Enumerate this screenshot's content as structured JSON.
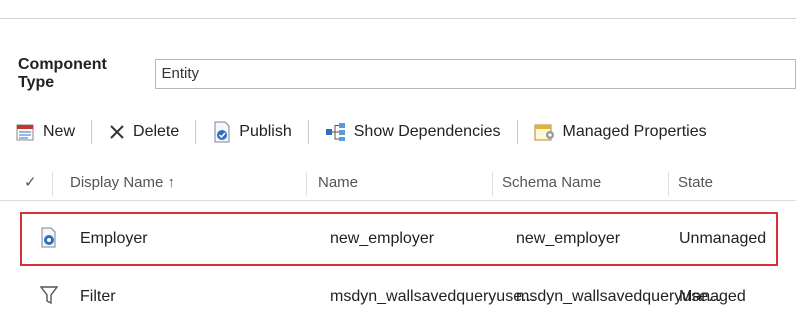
{
  "component_type": {
    "label": "Component Type",
    "value": "Entity"
  },
  "toolbar": {
    "new_label": "New",
    "delete_label": "Delete",
    "publish_label": "Publish",
    "show_dependencies_label": "Show Dependencies",
    "managed_properties_label": "Managed Properties"
  },
  "grid": {
    "check_column": "✓",
    "columns": [
      "Display Name ↑",
      "Name",
      "Schema Name",
      "State"
    ],
    "rows": [
      {
        "icon": "entity-icon",
        "display_name": "Employer",
        "name": "new_employer",
        "schema_name": "new_employer",
        "state": "Unmanaged",
        "highlighted": true
      },
      {
        "icon": "filter-icon",
        "display_name": "Filter",
        "name": "msdyn_wallsavedqueryuse...",
        "schema_name": "msdyn_wallsavedqueryuse...",
        "state": "Managed",
        "highlighted": false
      }
    ]
  },
  "colors": {
    "highlight_border": "#d8323c",
    "accent_blue": "#2f6fc0"
  }
}
